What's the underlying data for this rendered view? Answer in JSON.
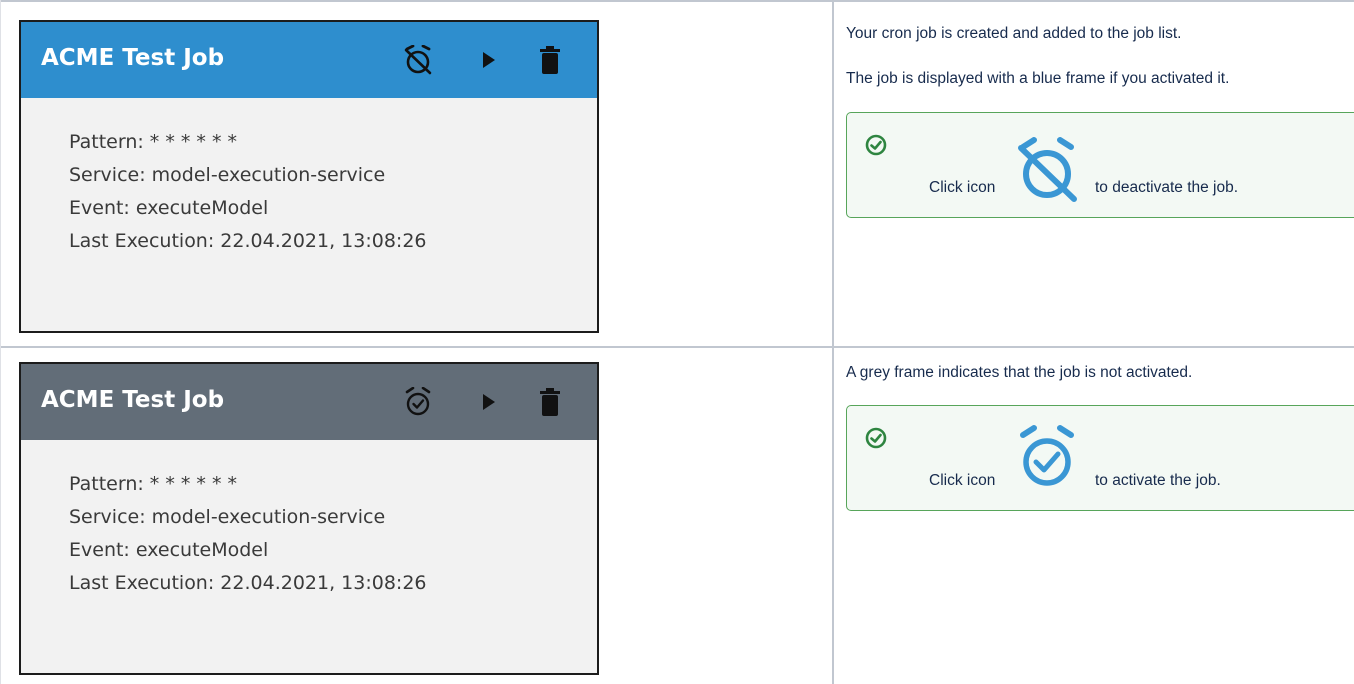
{
  "jobs": [
    {
      "title": "ACME Test Job",
      "state": "active",
      "header_color": "#2e8ece",
      "toggle_icon": "alarm-off-icon",
      "pattern": "Pattern: * * * * * *",
      "service": "Service: model-execution-service",
      "event": "Event: executeModel",
      "last_execution": "Last Execution: 22.04.2021, 13:08:26"
    },
    {
      "title": "ACME Test Job",
      "state": "inactive",
      "header_color": "#626d78",
      "toggle_icon": "alarm-check-icon",
      "pattern": "Pattern: * * * * * *",
      "service": "Service: model-execution-service",
      "event": "Event: executeModel",
      "last_execution": "Last Execution: 22.04.2021, 13:08:26"
    }
  ],
  "notes": {
    "row1_line1": "Your cron job is created and added to the job list.",
    "row1_line2": "The job is displayed with a blue frame if you activated it.",
    "row2_line1": "A grey frame indicates that the job is not activated."
  },
  "tips": [
    {
      "status_icon": "check-circle-icon",
      "prefix": "Click icon",
      "icon": "alarm-off-icon",
      "suffix": "to deactivate the job."
    },
    {
      "status_icon": "check-circle-icon",
      "prefix": "Click icon",
      "icon": "alarm-check-icon",
      "suffix": "to activate the job."
    }
  ],
  "colors": {
    "active_blue": "#2e8ece",
    "inactive_grey": "#626d78",
    "tip_green": "#57a55a",
    "icon_blue": "#3a97d4"
  }
}
